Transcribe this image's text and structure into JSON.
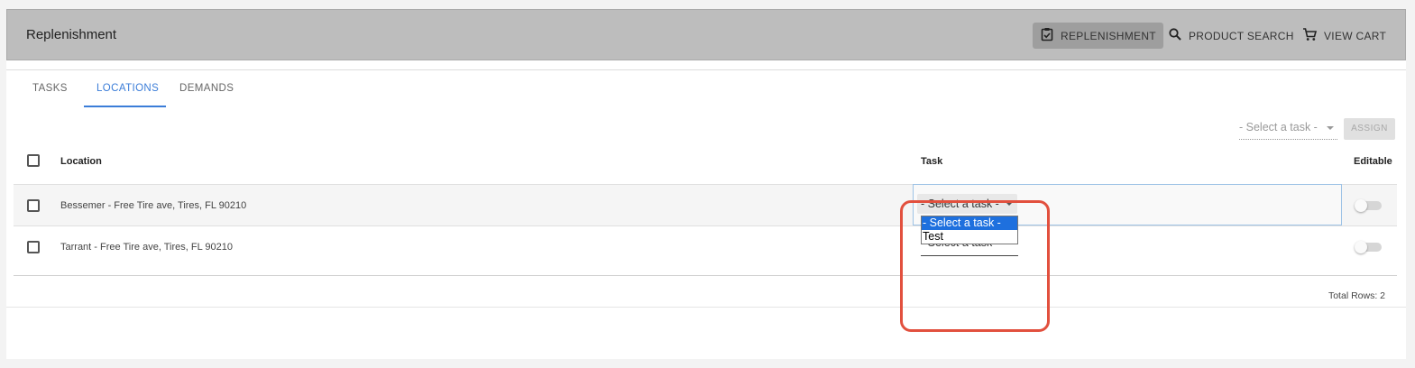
{
  "app": {
    "title": "Replenishment",
    "nav": [
      {
        "label": "REPLENISHMENT",
        "icon": "clipboard-check-icon",
        "active": true
      },
      {
        "label": "PRODUCT SEARCH",
        "icon": "search-icon",
        "active": false
      },
      {
        "label": "VIEW CART",
        "icon": "cart-icon",
        "active": false
      }
    ]
  },
  "tabs": [
    {
      "label": "TASKS",
      "active": false
    },
    {
      "label": "LOCATIONS",
      "active": true
    },
    {
      "label": "DEMANDS",
      "active": false
    }
  ],
  "toolbar": {
    "task_select_placeholder": "- Select a task -",
    "assign_label": "ASSIGN"
  },
  "table": {
    "columns": {
      "location": "Location",
      "task": "Task",
      "editable": "Editable"
    },
    "rows": [
      {
        "location": "Bessemer - Free Tire ave, Tires, FL 90210",
        "task": "- Select a task -",
        "editable": false,
        "selected": false
      },
      {
        "location": "Tarrant - Free Tire ave, Tires, FL 90210",
        "task": "- Select a task -",
        "editable": false,
        "selected": false
      }
    ],
    "total_rows": "Total Rows: 2"
  },
  "task_dropdown": {
    "options": [
      "- Select a task -",
      "Test"
    ],
    "highlighted_index": 0
  },
  "colors": {
    "appbar": "#bdbdbd",
    "accent": "#3b7dd8",
    "callout": "#e2503e",
    "dropdown_highlight": "#1e70de"
  }
}
